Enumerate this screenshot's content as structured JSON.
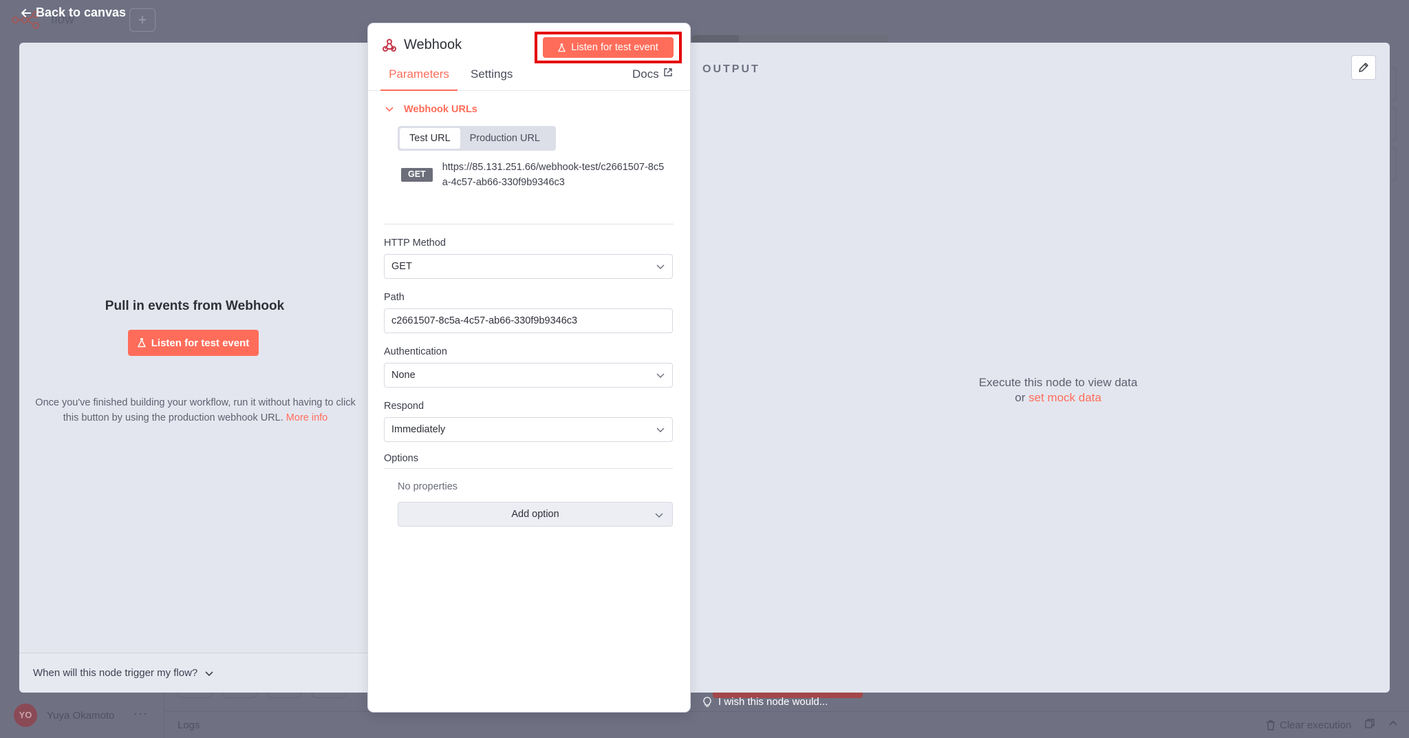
{
  "background": {
    "app_title": "flow",
    "add_label": "+",
    "user_initials": "YO",
    "user_name": "Yuya Okamoto",
    "user_more": "···",
    "logs_label": "Logs",
    "clear_execution_label": "Clear execution",
    "wish_label": "I wish this node would..."
  },
  "header": {
    "back_label": "Back to canvas"
  },
  "input_pane": {
    "title": "Pull in events from Webhook",
    "listen_label": "Listen for test event",
    "hint_text": "Once you've finished building your workflow, run it without having to click this button by using the production webhook URL.",
    "more_info_label": "More info",
    "trigger_question": "When will this node trigger my flow?"
  },
  "node": {
    "name": "Webhook",
    "listen_label": "Listen for test event",
    "tabs": {
      "parameters": "Parameters",
      "settings": "Settings",
      "docs": "Docs"
    },
    "webhook_urls": {
      "section_label": "Webhook URLs",
      "test_url_label": "Test URL",
      "production_url_label": "Production URL",
      "method_badge": "GET",
      "url": "https://85.131.251.66/webhook-test/c2661507-8c5a-4c57-ab66-330f9b9346c3"
    },
    "fields": {
      "http_method_label": "HTTP Method",
      "http_method_value": "GET",
      "path_label": "Path",
      "path_value": "c2661507-8c5a-4c57-ab66-330f9b9346c3",
      "authentication_label": "Authentication",
      "authentication_value": "None",
      "respond_label": "Respond",
      "respond_value": "Immediately"
    },
    "options": {
      "label": "Options",
      "empty_text": "No properties",
      "add_label": "Add option"
    }
  },
  "output_pane": {
    "label": "OUTPUT",
    "empty_line1": "Execute this node to view data",
    "empty_or": "or",
    "mock_link": "set mock data"
  },
  "colors": {
    "accent": "#ff6d5a",
    "highlight": "#e50000",
    "backdrop": "#6f7183",
    "shell": "#e4e6ef"
  }
}
